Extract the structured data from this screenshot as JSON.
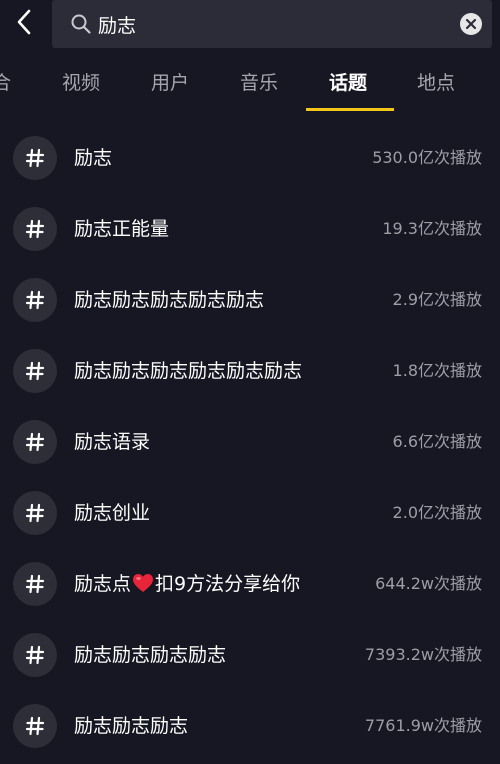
{
  "search": {
    "query": "励志"
  },
  "tabs": [
    {
      "label": "合"
    },
    {
      "label": "视频"
    },
    {
      "label": "用户"
    },
    {
      "label": "音乐"
    },
    {
      "label": "话题"
    },
    {
      "label": "地点"
    }
  ],
  "active_tab": "话题",
  "topics": [
    {
      "name": "励志",
      "count": "530.0亿次播放"
    },
    {
      "name": "励志正能量",
      "count": "19.3亿次播放"
    },
    {
      "name": "励志励志励志励志励志",
      "count": "2.9亿次播放"
    },
    {
      "name": "励志励志励志励志励志励志",
      "count": "1.8亿次播放"
    },
    {
      "name": "励志语录",
      "count": "6.6亿次播放"
    },
    {
      "name": "励志创业",
      "count": "2.0亿次播放"
    },
    {
      "name_prefix": "励志点",
      "name_suffix": "扣9方法分享给你",
      "count": "644.2w次播放"
    },
    {
      "name": "励志励志励志励志",
      "count": "7393.2w次播放"
    },
    {
      "name": "励志励志励志",
      "count": "7761.9w次播放"
    }
  ],
  "colors": {
    "background": "#161722",
    "search_box": "#2b2c37",
    "tab_inactive": "#a5a6ad",
    "tab_active": "#ffffff",
    "tab_underline": "#f5c518",
    "hash_circle": "#2d2e38",
    "count_text": "#9d9ea6",
    "heart": "#e8243a"
  },
  "icons": {
    "back": "chevron-left-icon",
    "search": "search-icon",
    "clear": "close-circle-icon",
    "hash": "hashtag-icon",
    "heart": "heart-emoji-icon"
  }
}
